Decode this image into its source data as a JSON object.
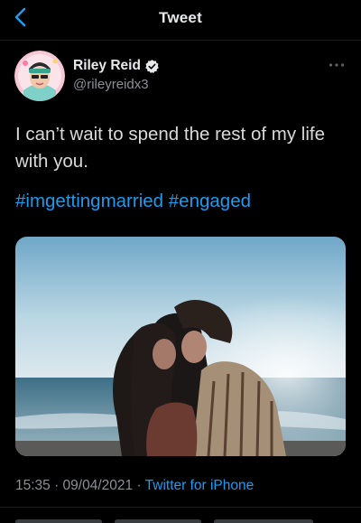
{
  "header": {
    "title": "Tweet",
    "back_icon": "chevron-left-icon",
    "accent": "#1d9bf0"
  },
  "author": {
    "display_name": "Riley Reid",
    "handle": "@rileyreidx3",
    "verified_icon": "verified-badge-icon",
    "more_icon": "more-horizontal-icon"
  },
  "tweet": {
    "text": "I can’t wait to spend the rest of my life with you.",
    "hashtags": [
      "#imgettingmarried",
      "#engaged"
    ],
    "timestamp": "15:35 · 09/04/2021 · ",
    "source": "Twitter for iPhone"
  },
  "colors": {
    "background": "#000000",
    "text": "#d9d9d9",
    "secondary": "#8b9096",
    "link": "#1d9bf0"
  }
}
